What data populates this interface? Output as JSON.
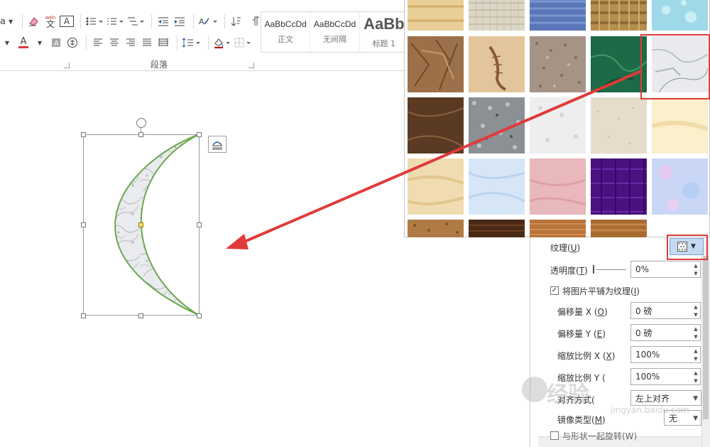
{
  "ribbon": {
    "paragraph_group_label": "段落",
    "style_gallery": [
      {
        "sample": "AaBbCcDd",
        "name": "正文"
      },
      {
        "sample": "AaBbCcDd",
        "name": "无间隔"
      },
      {
        "sample": "AaBb",
        "name": "标题 1"
      }
    ],
    "font_dropdown_text": "a",
    "wen_glyph_top": "wén",
    "wen_glyph": "文",
    "char_border_glyph": "A",
    "font_color_glyph": "A"
  },
  "format_pane": {
    "texture_label": "纹理(",
    "texture_key": "U",
    "texture_label_end": ")",
    "transparency_label": "透明度(",
    "transparency_key": "T",
    "transparency_value": "0%",
    "tile_label": "将图片平铺为纹理(",
    "tile_key": "I",
    "tile_checked": true,
    "offset_x_label": "偏移量 X (",
    "offset_x_key": "O",
    "offset_x_value": "0 磅",
    "offset_y_label": "偏移量 Y (",
    "offset_y_key": "E",
    "offset_y_value": "0 磅",
    "scale_x_label": "缩放比例 X (",
    "scale_x_key": "X",
    "scale_x_value": "100%",
    "scale_y_label": "缩放比例 Y (",
    "scale_y_value": "100%",
    "align_label": "对齐方式(",
    "align_value": "左上对齐",
    "mirror_label": "镜像类型(",
    "mirror_key": "M",
    "mirror_value": "无",
    "rotate_with_shape_label": "与形状一起旋转(W)",
    "label_close": ")"
  },
  "colors": {
    "selection_red": "#e03a3a",
    "moon_outline": "#6aa84f",
    "tex_button_bg": "#c5d9f1"
  },
  "watermark": {
    "text": "经验",
    "sub": "jingyan.baidu.com"
  },
  "icons": [
    "format-painter-icon",
    "font-color-icon",
    "bullets-icon",
    "numbering-icon",
    "multilevel-list-icon",
    "decrease-indent-icon",
    "increase-indent-icon",
    "chinese-layout-icon",
    "sort-icon",
    "show-marks-icon",
    "align-left-icon",
    "center-icon",
    "align-right-icon",
    "justify-icon",
    "distributed-icon",
    "line-spacing-icon",
    "shading-icon",
    "borders-icon",
    "layout-options-icon",
    "rotate-handle-icon",
    "texture-picker-icon"
  ]
}
